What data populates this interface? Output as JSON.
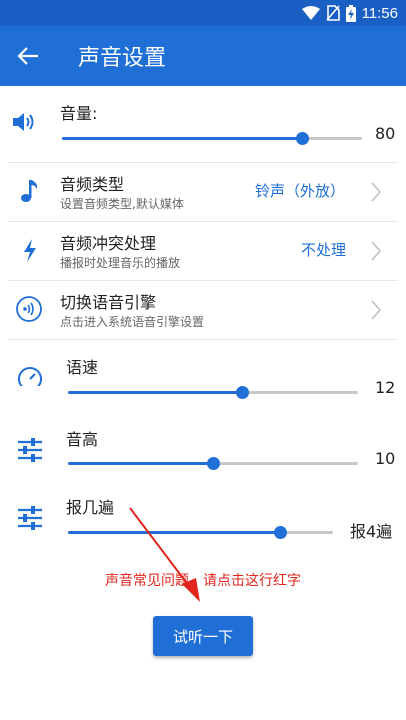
{
  "status": {
    "time": "11:56"
  },
  "appbar": {
    "title": "声音设置"
  },
  "volume": {
    "label": "音量:",
    "value": "80",
    "level": 0.8
  },
  "audio_type": {
    "label": "音频类型",
    "desc": "设置音频类型,默认媒体",
    "value": "铃声（外放）"
  },
  "conflict": {
    "label": "音频冲突处理",
    "desc": "播报时处理音乐的播放",
    "value": "不处理"
  },
  "engine": {
    "label": "切换语音引擎",
    "desc": "点击进入系统语音引擎设置"
  },
  "speed": {
    "label": "语速",
    "value": "12",
    "level": 0.6
  },
  "pitch": {
    "label": "音高",
    "value": "10",
    "level": 0.5
  },
  "repeat": {
    "label": "报几遍",
    "value": "报4遍",
    "level": 0.8
  },
  "help_link": "声音常见问题，请点击这行红字",
  "try_button": "试听一下",
  "colors": {
    "primary": "#1f6fd6",
    "statusbar": "#1a5fc4",
    "link_red": "#e0261c"
  }
}
